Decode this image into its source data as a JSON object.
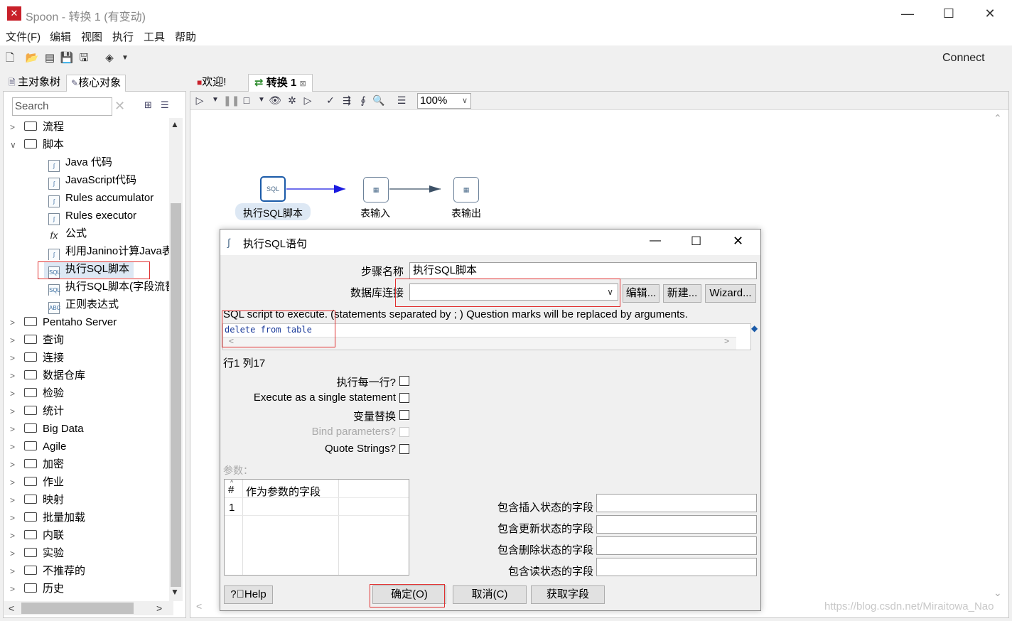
{
  "window": {
    "title": "Spoon - 转换 1 (有变动)",
    "app_icon": "spoon-icon"
  },
  "menu": [
    "文件(F)",
    "编辑",
    "视图",
    "执行",
    "工具",
    "帮助"
  ],
  "toolbar": {
    "connect_label": "Connect"
  },
  "left_panel": {
    "tabs": [
      "主对象树",
      "核心对象"
    ],
    "search_placeholder": "Search",
    "tree": [
      {
        "label": "流程",
        "expanded": false
      },
      {
        "label": "脚本",
        "expanded": true
      }
    ],
    "script_children": [
      "Java 代码",
      "JavaScript代码",
      "Rules accumulator",
      "Rules executor",
      "公式",
      "利用Janino计算Java表",
      "执行SQL脚本",
      "执行SQL脚本(字段流替",
      "正则表达式"
    ],
    "folders_after": [
      "Pentaho Server",
      "查询",
      "连接",
      "数据仓库",
      "检验",
      "统计",
      "Big Data",
      "Agile",
      "加密",
      "作业",
      "映射",
      "批量加载",
      "内联",
      "实验",
      "不推荐的",
      "历史"
    ]
  },
  "right_panel": {
    "tabs": [
      "欢迎!",
      "转换 1"
    ],
    "zoom": "100%",
    "steps": [
      "执行SQL脚本",
      "表输入",
      "表输出"
    ]
  },
  "dialog": {
    "title": "执行SQL语句",
    "step_name_label": "步骤名称",
    "step_name_value": "执行SQL脚本",
    "db_conn_label": "数据库连接",
    "db_conn_value": "",
    "edit_btn": "编辑...",
    "new_btn": "新建...",
    "wizard_btn": "Wizard...",
    "sql_hint": "SQL script to execute. (statements separated by ; ) Question marks will be replaced by arguments.",
    "sql_text": "delete from table",
    "cursor_pos": "行1 列17",
    "checkboxes": [
      {
        "label": "执行每一行?",
        "checked": false,
        "enabled": true
      },
      {
        "label": "Execute as a single statement",
        "checked": false,
        "enabled": true
      },
      {
        "label": "变量替换",
        "checked": false,
        "enabled": true
      },
      {
        "label": "Bind parameters?",
        "checked": false,
        "enabled": false
      },
      {
        "label": "Quote Strings?",
        "checked": false,
        "enabled": true
      }
    ],
    "params_label": "参数：",
    "params_table": {
      "headers": [
        "#",
        "作为参数的字段"
      ],
      "rows": [
        {
          "num": "1",
          "field": ""
        }
      ]
    },
    "status_fields": [
      {
        "label": "包含插入状态的字段",
        "value": ""
      },
      {
        "label": "包含更新状态的字段",
        "value": ""
      },
      {
        "label": "包含删除状态的字段",
        "value": ""
      },
      {
        "label": "包含读状态的字段",
        "value": ""
      }
    ],
    "help_btn": "Help",
    "ok_btn": "确定(O)",
    "cancel_btn": "取消(C)",
    "get_fields_btn": "获取字段"
  },
  "watermark": "https://blog.csdn.net/Miraitowa_Nao",
  "colors": {
    "highlight": "#dde8f4",
    "red_annotation": "#e03030",
    "hop_blue": "#1a1ae0",
    "hop_grey": "#3c5066"
  }
}
